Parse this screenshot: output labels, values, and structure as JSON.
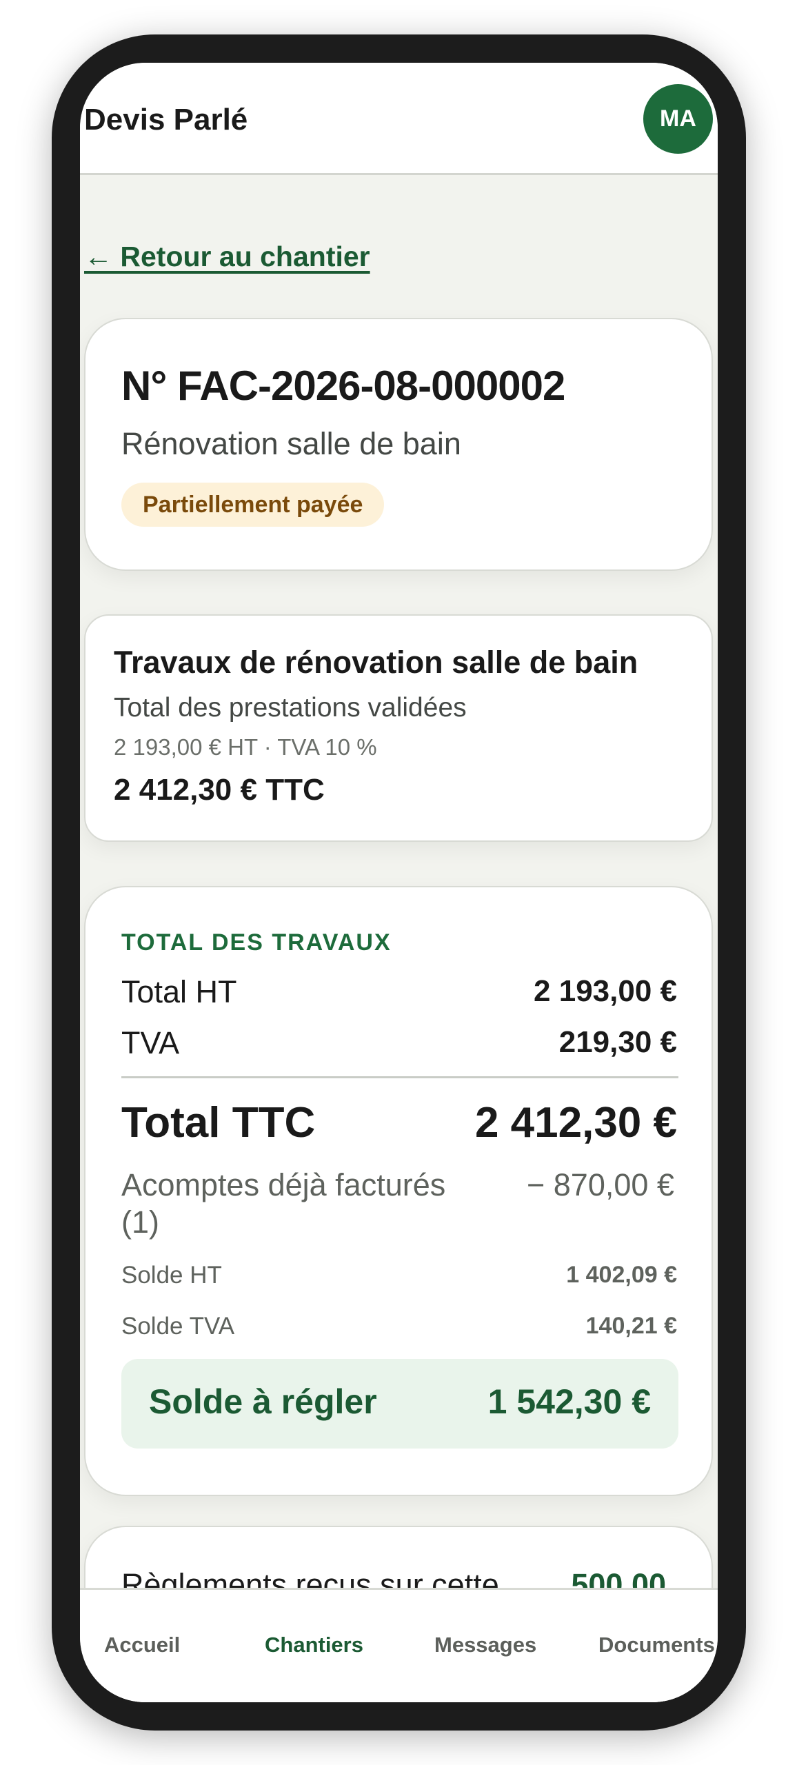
{
  "header": {
    "app_title": "Devis Parlé",
    "avatar_initials": "MA"
  },
  "navigation": {
    "back_link": "← Retour au chantier"
  },
  "invoice": {
    "number": "N° FAC-2026-08-000002",
    "project": "Rénovation salle de bain",
    "status": "Partiellement payée"
  },
  "service": {
    "title": "Travaux de rénovation salle de bain",
    "subtitle": "Total des prestations validées",
    "detail": "2 193,00 € HT · TVA 10 %",
    "total": "2 412,30 € TTC"
  },
  "totals": {
    "heading": "TOTAL DES TRAVAUX",
    "ht_label": "Total HT",
    "ht_value": "2 193,00 €",
    "tva_label": "TVA",
    "tva_value": "219,30 €",
    "ttc_label": "Total TTC",
    "ttc_value": "2 412,30 €",
    "acomptes_label": "Acomptes déjà facturés (1)",
    "acomptes_value": "− 870,00 €",
    "solde_ht_label": "Solde HT",
    "solde_ht_value": "1 402,09 €",
    "solde_tva_label": "Solde TVA",
    "solde_tva_value": "140,21 €",
    "balance_label": "Solde à régler",
    "balance_value": "1 542,30 €"
  },
  "payments": {
    "label": "Règlements reçus sur cette",
    "value": "500,00"
  },
  "bottom_nav": {
    "items": [
      {
        "label": "Accueil",
        "active": false
      },
      {
        "label": "Chantiers",
        "active": true
      },
      {
        "label": "Messages",
        "active": false
      },
      {
        "label": "Documents",
        "active": false
      }
    ]
  },
  "colors": {
    "accent_green": "#1d6b3b",
    "status_badge_bg": "#fdf1d8",
    "balance_bg": "#e9f4eb"
  }
}
